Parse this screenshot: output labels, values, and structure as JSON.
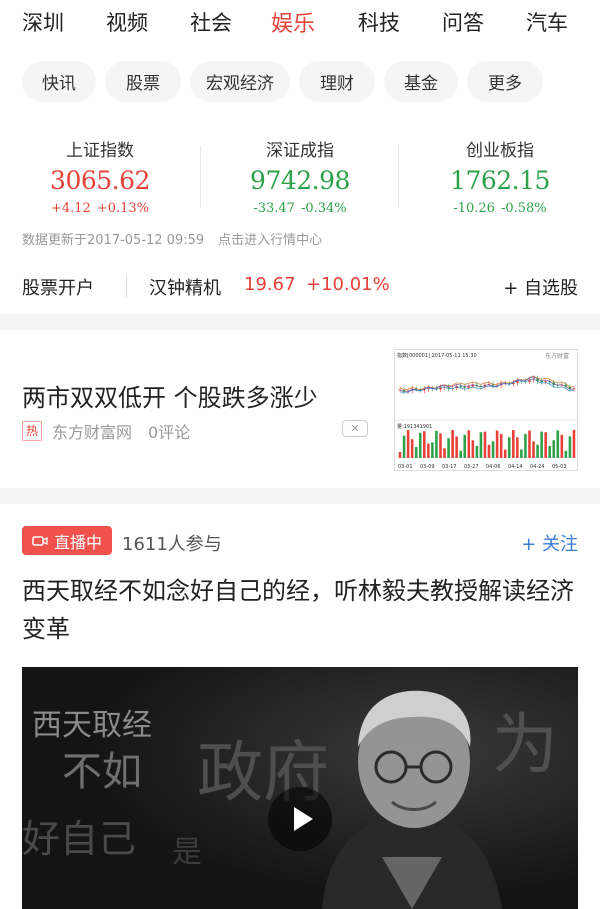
{
  "nav": {
    "tabs": [
      {
        "label": "深圳"
      },
      {
        "label": "视频"
      },
      {
        "label": "社会"
      },
      {
        "label": "娱乐"
      },
      {
        "label": "科技"
      },
      {
        "label": "问答"
      },
      {
        "label": "汽车"
      }
    ],
    "active_tab": "娱乐"
  },
  "subnav": {
    "pills": [
      "快讯",
      "股票",
      "宏观经济",
      "理财",
      "基金",
      "更多"
    ]
  },
  "indices": [
    {
      "name": "上证指数",
      "value": "3065.62",
      "change": "+4.12",
      "change_pct": "+0.13%",
      "trend": "up"
    },
    {
      "name": "深证成指",
      "value": "9742.98",
      "change": "-33.47",
      "change_pct": "-0.34%",
      "trend": "down"
    },
    {
      "name": "创业板指",
      "value": "1762.15",
      "change": "-10.26",
      "change_pct": "-0.58%",
      "trend": "down"
    }
  ],
  "update_info": {
    "text": "数据更新于2017-05-12 09:59",
    "link": "点击进入行情中心"
  },
  "stock_strip": {
    "open_account": "股票开户",
    "stock_name": "汉钟精机",
    "price": "19.67",
    "change_pct": "+10.01%",
    "watchlist": "+ 自选股"
  },
  "news": {
    "title": "两市双双低开 个股跌多涨少",
    "hot_badge": "热",
    "source": "东方财富网",
    "comments": "0评论",
    "close_glyph": "✕",
    "thumbnail": {
      "header": "指数[000001] 2017-05-11 15:30",
      "brand": "东方财富",
      "volume_label": "量:191341901",
      "dates": [
        "03-01",
        "03-09",
        "03-17",
        "03-27",
        "04-06",
        "04-14",
        "04-24",
        "05-03"
      ]
    }
  },
  "live": {
    "badge": "直播中",
    "participants": "1611人参与",
    "follow": "+ 关注",
    "title": "西天取经不如念好自己的经，听林毅夫教授解读经济变革",
    "poster_text": [
      "西天取经",
      "不如",
      "好自己",
      "是",
      "政府",
      "为"
    ]
  },
  "colors": {
    "accent": "#e8413a",
    "up": "#e8413a",
    "down": "#2da24a",
    "link": "#3a7bd5",
    "live": "#f0524b"
  }
}
